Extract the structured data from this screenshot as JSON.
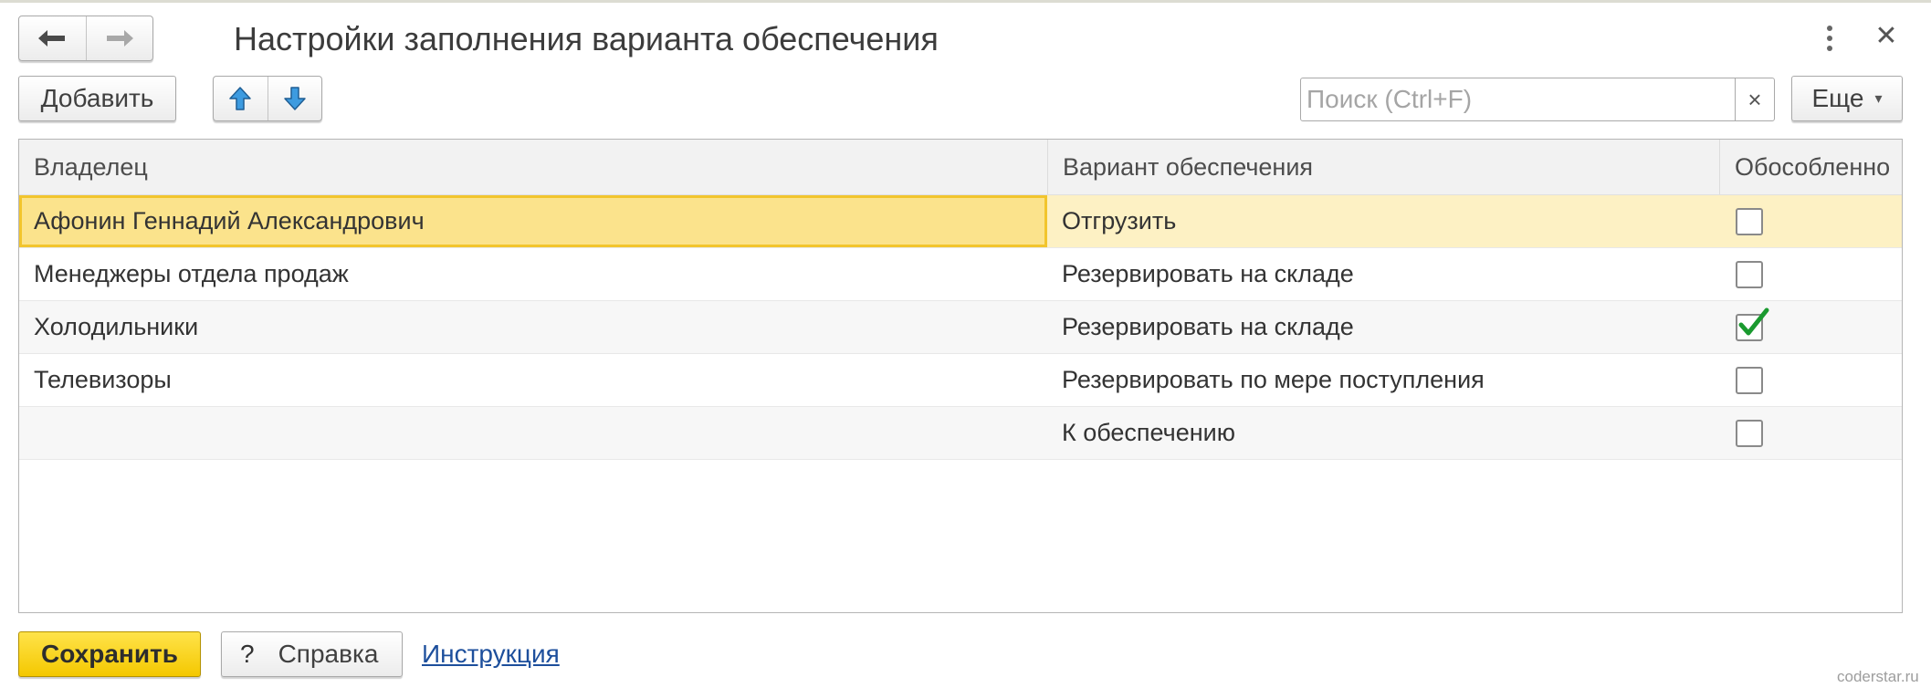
{
  "window": {
    "title": "Настройки заполнения варианта обеспечения",
    "menu_icon": "more-vertical-icon",
    "close_icon": "close-icon",
    "close_glyph": "✕"
  },
  "nav": {
    "back_icon": "arrow-left-icon",
    "forward_icon": "arrow-right-icon"
  },
  "toolbar": {
    "add_label": "Добавить",
    "move_up_icon": "arrow-up-icon",
    "move_down_icon": "arrow-down-icon",
    "search_placeholder": "Поиск (Ctrl+F)",
    "search_value": "",
    "clear_glyph": "×",
    "more_label": "Еще",
    "more_glyph": "▾"
  },
  "table": {
    "columns": [
      "Владелец",
      "Вариант обеспечения",
      "Обособленно"
    ],
    "rows": [
      {
        "owner": "Афонин Геннадий Александрович",
        "variant": "Отгрузить",
        "separate": false,
        "selected": true
      },
      {
        "owner": "Менеджеры отдела продаж",
        "variant": "Резервировать на складе",
        "separate": false,
        "selected": false
      },
      {
        "owner": "Холодильники",
        "variant": "Резервировать на складе",
        "separate": true,
        "selected": false
      },
      {
        "owner": "Телевизоры",
        "variant": "Резервировать по мере поступления",
        "separate": false,
        "selected": false
      },
      {
        "owner": "",
        "variant": "К обеспечению",
        "separate": false,
        "selected": false
      }
    ]
  },
  "footer": {
    "save_label": "Сохранить",
    "help_glyph": "?",
    "help_label": "Справка",
    "instruction_link": "Инструкция"
  },
  "watermark": "coderstar.ru",
  "colors": {
    "accent_yellow": "#f4c800",
    "selected_row": "#fdf1c4",
    "selected_cell": "#fbe38c",
    "check_green": "#1a9a2f",
    "arrow_blue": "#3d9be0",
    "link_blue": "#1d4f9c"
  }
}
